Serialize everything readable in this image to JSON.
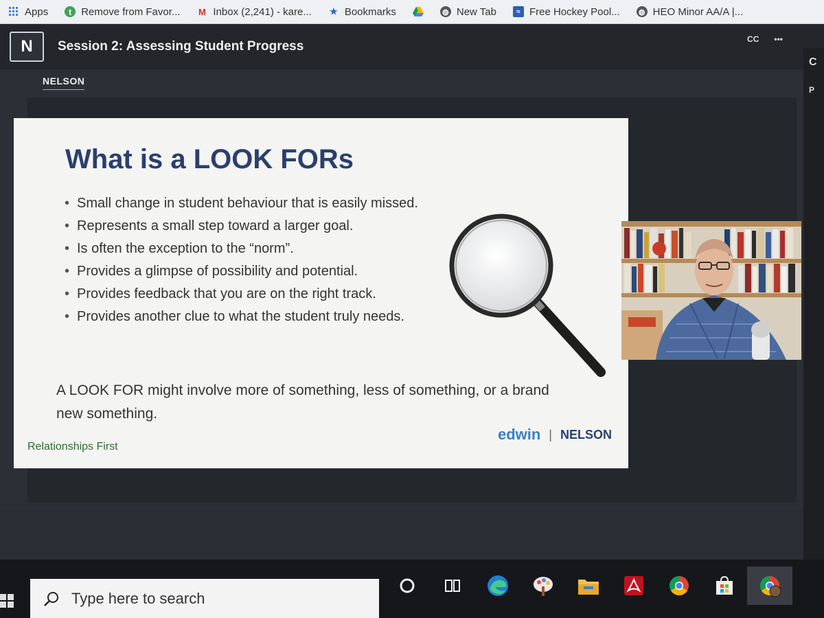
{
  "bookmarks": [
    {
      "label": "Apps",
      "icon": "apps-grid-icon"
    },
    {
      "label": "Remove from Favor...",
      "icon": "favorites-icon"
    },
    {
      "label": "Inbox (2,241) - kare...",
      "icon": "gmail-icon"
    },
    {
      "label": "Bookmarks",
      "icon": "star-icon"
    },
    {
      "label": "",
      "icon": "drive-icon"
    },
    {
      "label": "New Tab",
      "icon": "globe-icon"
    },
    {
      "label": "Free Hockey Pool...",
      "icon": "hockey-icon"
    },
    {
      "label": "HEO Minor AA/A |...",
      "icon": "globe-icon"
    }
  ],
  "app": {
    "logo_letter": "N",
    "session_title": "Session 2: Assessing Student Progress",
    "cc_label": "CC",
    "more_label": "•••",
    "side_letter": "C",
    "side_letter_2": "P",
    "brand_label": "NELSON"
  },
  "slide": {
    "title": "What is a LOOK FORs",
    "bullets": [
      "Small change in student behaviour that is easily missed.",
      "Represents a small step toward a larger goal.",
      "Is often the exception to the “norm”.",
      "Provides a glimpse of possibility and potential.",
      "Provides feedback that you are on the right track.",
      "Provides another clue to what the student truly needs."
    ],
    "summary": "A LOOK FOR might involve more of something, less of something, or a brand new something.",
    "footer_left": "Relationships First",
    "footer_brand_1": "edwin",
    "footer_sep": "|",
    "footer_brand_2": "NELSON"
  },
  "taskbar": {
    "search_placeholder": "Type here to search",
    "icons": [
      "cortana-circle-icon",
      "task-view-icon",
      "edge-icon",
      "paint-icon",
      "file-explorer-icon",
      "acrobat-icon",
      "chrome-icon",
      "store-icon",
      "chrome-profile-icon"
    ]
  },
  "colors": {
    "slide_title": "#2b3f6e",
    "edwin": "#3b7fc4",
    "footer_left": "#2f6b2f"
  }
}
